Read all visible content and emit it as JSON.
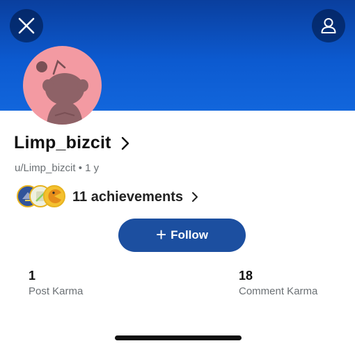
{
  "profile": {
    "username": "Limp_bizcit",
    "handle": "u/Limp_bizcit",
    "separator": "•",
    "age": "1 y",
    "avatar_color": "#f39aa2",
    "header_color": "#0c5ad0"
  },
  "achievements": {
    "label": "11 achievements",
    "badge_icons": [
      "gem-badge-icon",
      "scroll-badge-icon",
      "pacman-badge-icon"
    ]
  },
  "follow": {
    "label": "Follow",
    "icon": "+"
  },
  "stats": {
    "post_karma_value": "1",
    "post_karma_label": "Post Karma",
    "comment_karma_value": "18",
    "comment_karma_label": "Comment Karma"
  }
}
